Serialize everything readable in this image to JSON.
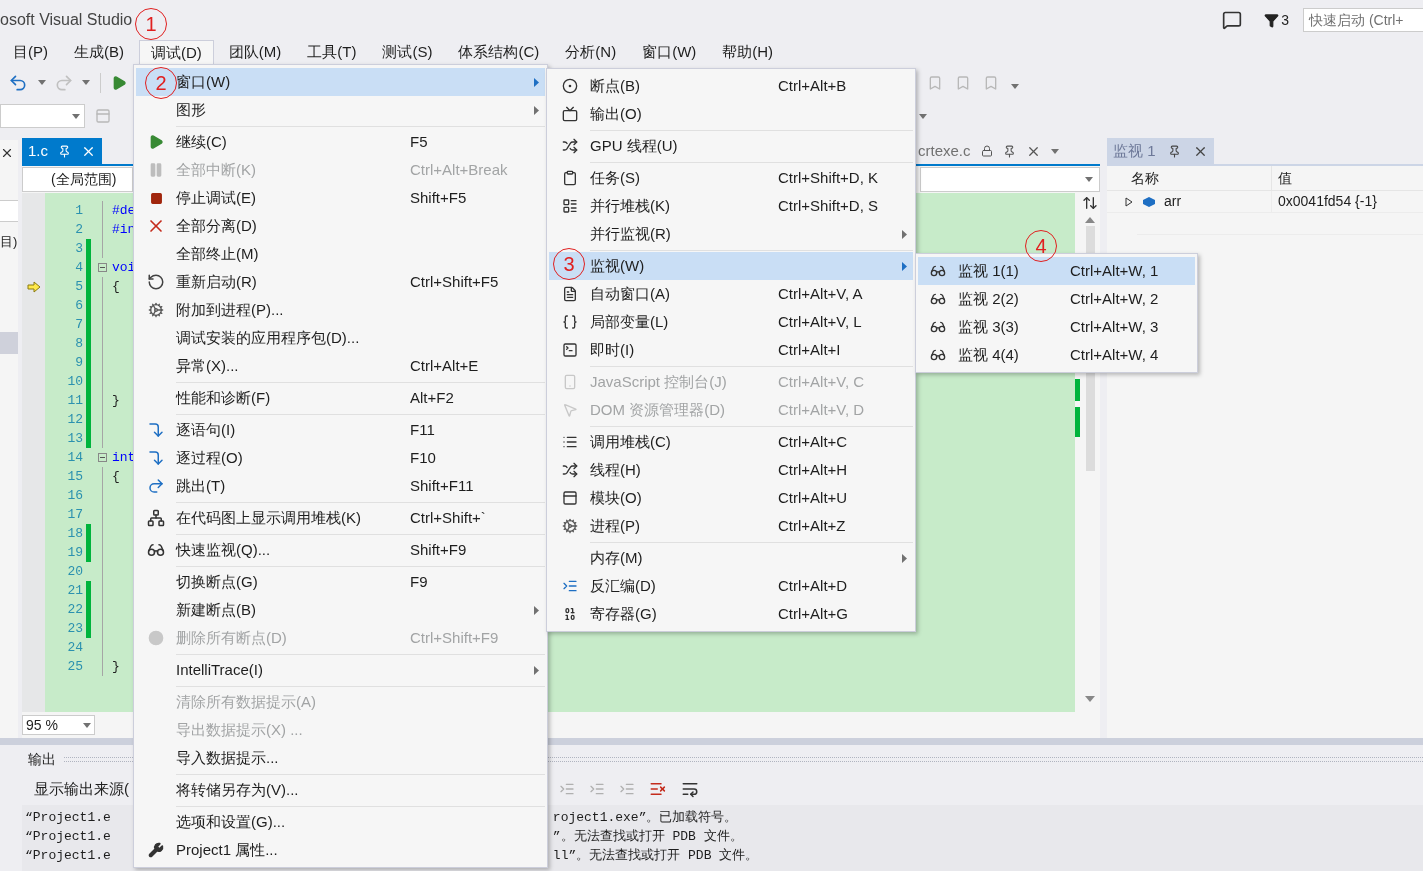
{
  "title": "osoft Visual Studio",
  "annotations": [
    {
      "text": "1"
    },
    {
      "text": "2"
    },
    {
      "text": "3"
    },
    {
      "text": "4"
    }
  ],
  "notification_count": "3",
  "quick_launch": {
    "placeholder": "快速启动 (Ctrl+"
  },
  "menu_bar": [
    {
      "label": "目(P)",
      "selected": false
    },
    {
      "label": "生成(B)",
      "selected": false
    },
    {
      "label": "调试(D)",
      "selected": true
    },
    {
      "label": "团队(M)",
      "selected": false
    },
    {
      "label": "工具(T)",
      "selected": false
    },
    {
      "label": "测试(S)",
      "selected": false
    },
    {
      "label": "体系结构(C)",
      "selected": false
    },
    {
      "label": "分析(N)",
      "selected": false
    },
    {
      "label": "窗口(W)",
      "selected": false
    },
    {
      "label": "帮助(H)",
      "selected": false
    }
  ],
  "left_panel": {
    "fragment": "目)"
  },
  "editor": {
    "tabs": [
      {
        "label": "1.c",
        "selected": true
      },
      {
        "label": "crtexe.c",
        "selected": false
      }
    ],
    "scope": "(全局范围)",
    "zoom": "95 %",
    "lines": [
      {
        "number": "1",
        "code": "#de",
        "changed": false,
        "fold": false,
        "current": false
      },
      {
        "number": "2",
        "code": "#in",
        "changed": false,
        "fold": false,
        "current": false
      },
      {
        "number": "3",
        "changed": true,
        "fold": false,
        "current": false
      },
      {
        "number": "4",
        "code": "voi",
        "changed": true,
        "fold": true,
        "current": false
      },
      {
        "number": "5",
        "code": "{",
        "changed": true,
        "fold": false,
        "current": true
      },
      {
        "number": "6",
        "changed": true,
        "fold": false,
        "current": false
      },
      {
        "number": "7",
        "changed": true,
        "fold": false,
        "current": false
      },
      {
        "number": "8",
        "changed": true,
        "fold": false,
        "current": false
      },
      {
        "number": "9",
        "changed": true,
        "fold": false,
        "current": false
      },
      {
        "number": "10",
        "changed": true,
        "fold": false,
        "current": false
      },
      {
        "number": "11",
        "code": "}",
        "changed": true,
        "fold": false,
        "current": false
      },
      {
        "number": "12",
        "changed": true,
        "fold": false,
        "current": false
      },
      {
        "number": "13",
        "changed": true,
        "fold": false,
        "current": false
      },
      {
        "number": "14",
        "code": "int",
        "changed": false,
        "fold": true,
        "current": false
      },
      {
        "number": "15",
        "code": "{",
        "changed": false,
        "fold": false,
        "current": false
      },
      {
        "number": "16",
        "changed": false,
        "fold": false,
        "current": false
      },
      {
        "number": "17",
        "changed": false,
        "fold": false,
        "current": false
      },
      {
        "number": "18",
        "changed": true,
        "fold": false,
        "current": false
      },
      {
        "number": "19",
        "changed": true,
        "fold": false,
        "current": false
      },
      {
        "number": "20",
        "changed": false,
        "fold": false,
        "current": false
      },
      {
        "number": "21",
        "changed": true,
        "fold": false,
        "current": false
      },
      {
        "number": "22",
        "changed": true,
        "fold": false,
        "current": false
      },
      {
        "number": "23",
        "changed": true,
        "fold": false,
        "current": false
      },
      {
        "number": "24",
        "changed": false,
        "fold": false,
        "current": false
      },
      {
        "number": "25",
        "code": "}",
        "changed": false,
        "fold": false,
        "current": false
      }
    ]
  },
  "watch": {
    "tab": "监视 1",
    "columns": [
      "名称",
      "值"
    ],
    "rows": [
      {
        "name": "arr",
        "value": "0x0041fd54 {-1}",
        "expanded": false
      }
    ]
  },
  "output": {
    "title": "输出",
    "source_label": "显示输出来源(",
    "lines": [
      {
        "left": "“Project1.e",
        "right": "roject1.exe”。已加载符号。"
      },
      {
        "left": "“Project1.e",
        "right": "”。无法查找或打开 PDB 文件。"
      },
      {
        "left": "“Project1.e",
        "right": "ll”。无法查找或打开 PDB 文件。"
      }
    ]
  },
  "debug_menu": [
    {
      "kind": "item",
      "label": "窗口(W)",
      "selected": true,
      "disabled": false,
      "submenu": true
    },
    {
      "kind": "item",
      "label": "图形",
      "selected": false,
      "disabled": false,
      "submenu": true
    },
    {
      "kind": "separator"
    },
    {
      "kind": "item",
      "label": "继续(C)",
      "shortcut": "F5",
      "selected": false,
      "disabled": false,
      "submenu": false
    },
    {
      "kind": "item",
      "label": "全部中断(K)",
      "shortcut": "Ctrl+Alt+Break",
      "selected": false,
      "disabled": true,
      "submenu": false
    },
    {
      "kind": "item",
      "label": "停止调试(E)",
      "shortcut": "Shift+F5",
      "selected": false,
      "disabled": false,
      "submenu": false
    },
    {
      "kind": "item",
      "label": "全部分离(D)",
      "selected": false,
      "disabled": false,
      "submenu": false
    },
    {
      "kind": "item",
      "label": "全部终止(M)",
      "selected": false,
      "disabled": false,
      "submenu": false
    },
    {
      "kind": "item",
      "label": "重新启动(R)",
      "shortcut": "Ctrl+Shift+F5",
      "selected": false,
      "disabled": false,
      "submenu": false
    },
    {
      "kind": "item",
      "label": "附加到进程(P)...",
      "selected": false,
      "disabled": false,
      "submenu": false
    },
    {
      "kind": "item",
      "label": "调试安装的应用程序包(D)...",
      "selected": false,
      "disabled": false,
      "submenu": false
    },
    {
      "kind": "item",
      "label": "异常(X)...",
      "shortcut": "Ctrl+Alt+E",
      "selected": false,
      "disabled": false,
      "submenu": false
    },
    {
      "kind": "separator"
    },
    {
      "kind": "item",
      "label": "性能和诊断(F)",
      "shortcut": "Alt+F2",
      "selected": false,
      "disabled": false,
      "submenu": false
    },
    {
      "kind": "separator"
    },
    {
      "kind": "item",
      "label": "逐语句(I)",
      "shortcut": "F11",
      "selected": false,
      "disabled": false,
      "submenu": false
    },
    {
      "kind": "item",
      "label": "逐过程(O)",
      "shortcut": "F10",
      "selected": false,
      "disabled": false,
      "submenu": false
    },
    {
      "kind": "item",
      "label": "跳出(T)",
      "shortcut": "Shift+F11",
      "selected": false,
      "disabled": false,
      "submenu": false
    },
    {
      "kind": "separator"
    },
    {
      "kind": "item",
      "label": "在代码图上显示调用堆栈(K)",
      "shortcut": "Ctrl+Shift+`",
      "selected": false,
      "disabled": false,
      "submenu": false
    },
    {
      "kind": "separator"
    },
    {
      "kind": "item",
      "label": "快速监视(Q)...",
      "shortcut": "Shift+F9",
      "selected": false,
      "disabled": false,
      "submenu": false
    },
    {
      "kind": "separator"
    },
    {
      "kind": "item",
      "label": "切换断点(G)",
      "shortcut": "F9",
      "selected": false,
      "disabled": false,
      "submenu": false
    },
    {
      "kind": "item",
      "label": "新建断点(B)",
      "selected": false,
      "disabled": false,
      "submenu": true
    },
    {
      "kind": "item",
      "label": "删除所有断点(D)",
      "shortcut": "Ctrl+Shift+F9",
      "selected": false,
      "disabled": true,
      "submenu": false
    },
    {
      "kind": "separator"
    },
    {
      "kind": "item",
      "label": "IntelliTrace(I)",
      "selected": false,
      "disabled": false,
      "submenu": true
    },
    {
      "kind": "separator"
    },
    {
      "kind": "item",
      "label": "清除所有数据提示(A)",
      "selected": false,
      "disabled": true,
      "submenu": false
    },
    {
      "kind": "item",
      "label": "导出数据提示(X) ...",
      "selected": false,
      "disabled": true,
      "submenu": false
    },
    {
      "kind": "item",
      "label": "导入数据提示...",
      "selected": false,
      "disabled": false,
      "submenu": false
    },
    {
      "kind": "separator"
    },
    {
      "kind": "item",
      "label": "将转储另存为(V)...",
      "selected": false,
      "disabled": false,
      "submenu": false
    },
    {
      "kind": "separator"
    },
    {
      "kind": "item",
      "label": "选项和设置(G)...",
      "selected": false,
      "disabled": false,
      "submenu": false
    },
    {
      "kind": "item",
      "label": "Project1 属性...",
      "selected": false,
      "disabled": false,
      "submenu": false
    }
  ],
  "window_submenu": [
    {
      "kind": "item",
      "label": "断点(B)",
      "shortcut": "Ctrl+Alt+B",
      "selected": false,
      "disabled": false,
      "submenu": false
    },
    {
      "kind": "item",
      "label": "输出(O)",
      "selected": false,
      "disabled": false,
      "submenu": false
    },
    {
      "kind": "separator"
    },
    {
      "kind": "item",
      "label": "GPU 线程(U)",
      "selected": false,
      "disabled": false,
      "submenu": false
    },
    {
      "kind": "separator"
    },
    {
      "kind": "item",
      "label": "任务(S)",
      "shortcut": "Ctrl+Shift+D, K",
      "selected": false,
      "disabled": false,
      "submenu": false
    },
    {
      "kind": "item",
      "label": "并行堆栈(K)",
      "shortcut": "Ctrl+Shift+D, S",
      "selected": false,
      "disabled": false,
      "submenu": false
    },
    {
      "kind": "item",
      "label": "并行监视(R)",
      "selected": false,
      "disabled": false,
      "submenu": true
    },
    {
      "kind": "separator"
    },
    {
      "kind": "item",
      "label": "监视(W)",
      "selected": true,
      "disabled": false,
      "submenu": true
    },
    {
      "kind": "item",
      "label": "自动窗口(A)",
      "shortcut": "Ctrl+Alt+V, A",
      "selected": false,
      "disabled": false,
      "submenu": false
    },
    {
      "kind": "item",
      "label": "局部变量(L)",
      "shortcut": "Ctrl+Alt+V, L",
      "selected": false,
      "disabled": false,
      "submenu": false
    },
    {
      "kind": "item",
      "label": "即时(I)",
      "shortcut": "Ctrl+Alt+I",
      "selected": false,
      "disabled": false,
      "submenu": false
    },
    {
      "kind": "separator"
    },
    {
      "kind": "item",
      "label": "JavaScript 控制台(J)",
      "shortcut": "Ctrl+Alt+V, C",
      "selected": false,
      "disabled": true,
      "submenu": false
    },
    {
      "kind": "item",
      "label": "DOM 资源管理器(D)",
      "shortcut": "Ctrl+Alt+V, D",
      "selected": false,
      "disabled": true,
      "submenu": false
    },
    {
      "kind": "separator"
    },
    {
      "kind": "item",
      "label": "调用堆栈(C)",
      "shortcut": "Ctrl+Alt+C",
      "selected": false,
      "disabled": false,
      "submenu": false
    },
    {
      "kind": "item",
      "label": "线程(H)",
      "shortcut": "Ctrl+Alt+H",
      "selected": false,
      "disabled": false,
      "submenu": false
    },
    {
      "kind": "item",
      "label": "模块(O)",
      "shortcut": "Ctrl+Alt+U",
      "selected": false,
      "disabled": false,
      "submenu": false
    },
    {
      "kind": "item",
      "label": "进程(P)",
      "shortcut": "Ctrl+Alt+Z",
      "selected": false,
      "disabled": false,
      "submenu": false
    },
    {
      "kind": "separator"
    },
    {
      "kind": "item",
      "label": "内存(M)",
      "selected": false,
      "disabled": false,
      "submenu": true
    },
    {
      "kind": "item",
      "label": "反汇编(D)",
      "shortcut": "Ctrl+Alt+D",
      "selected": false,
      "disabled": false,
      "submenu": false
    },
    {
      "kind": "item",
      "label": "寄存器(G)",
      "shortcut": "Ctrl+Alt+G",
      "selected": false,
      "disabled": false,
      "submenu": false
    }
  ],
  "watch_submenu": [
    {
      "kind": "item",
      "label": "监视 1(1)",
      "shortcut": "Ctrl+Alt+W, 1",
      "selected": true,
      "disabled": false,
      "submenu": false
    },
    {
      "kind": "item",
      "label": "监视 2(2)",
      "shortcut": "Ctrl+Alt+W, 2",
      "selected": false,
      "disabled": false,
      "submenu": false
    },
    {
      "kind": "item",
      "label": "监视 3(3)",
      "shortcut": "Ctrl+Alt+W, 3",
      "selected": false,
      "disabled": false,
      "submenu": false
    },
    {
      "kind": "item",
      "label": "监视 4(4)",
      "shortcut": "Ctrl+Alt+W, 4",
      "selected": false,
      "disabled": false,
      "submenu": false
    }
  ]
}
